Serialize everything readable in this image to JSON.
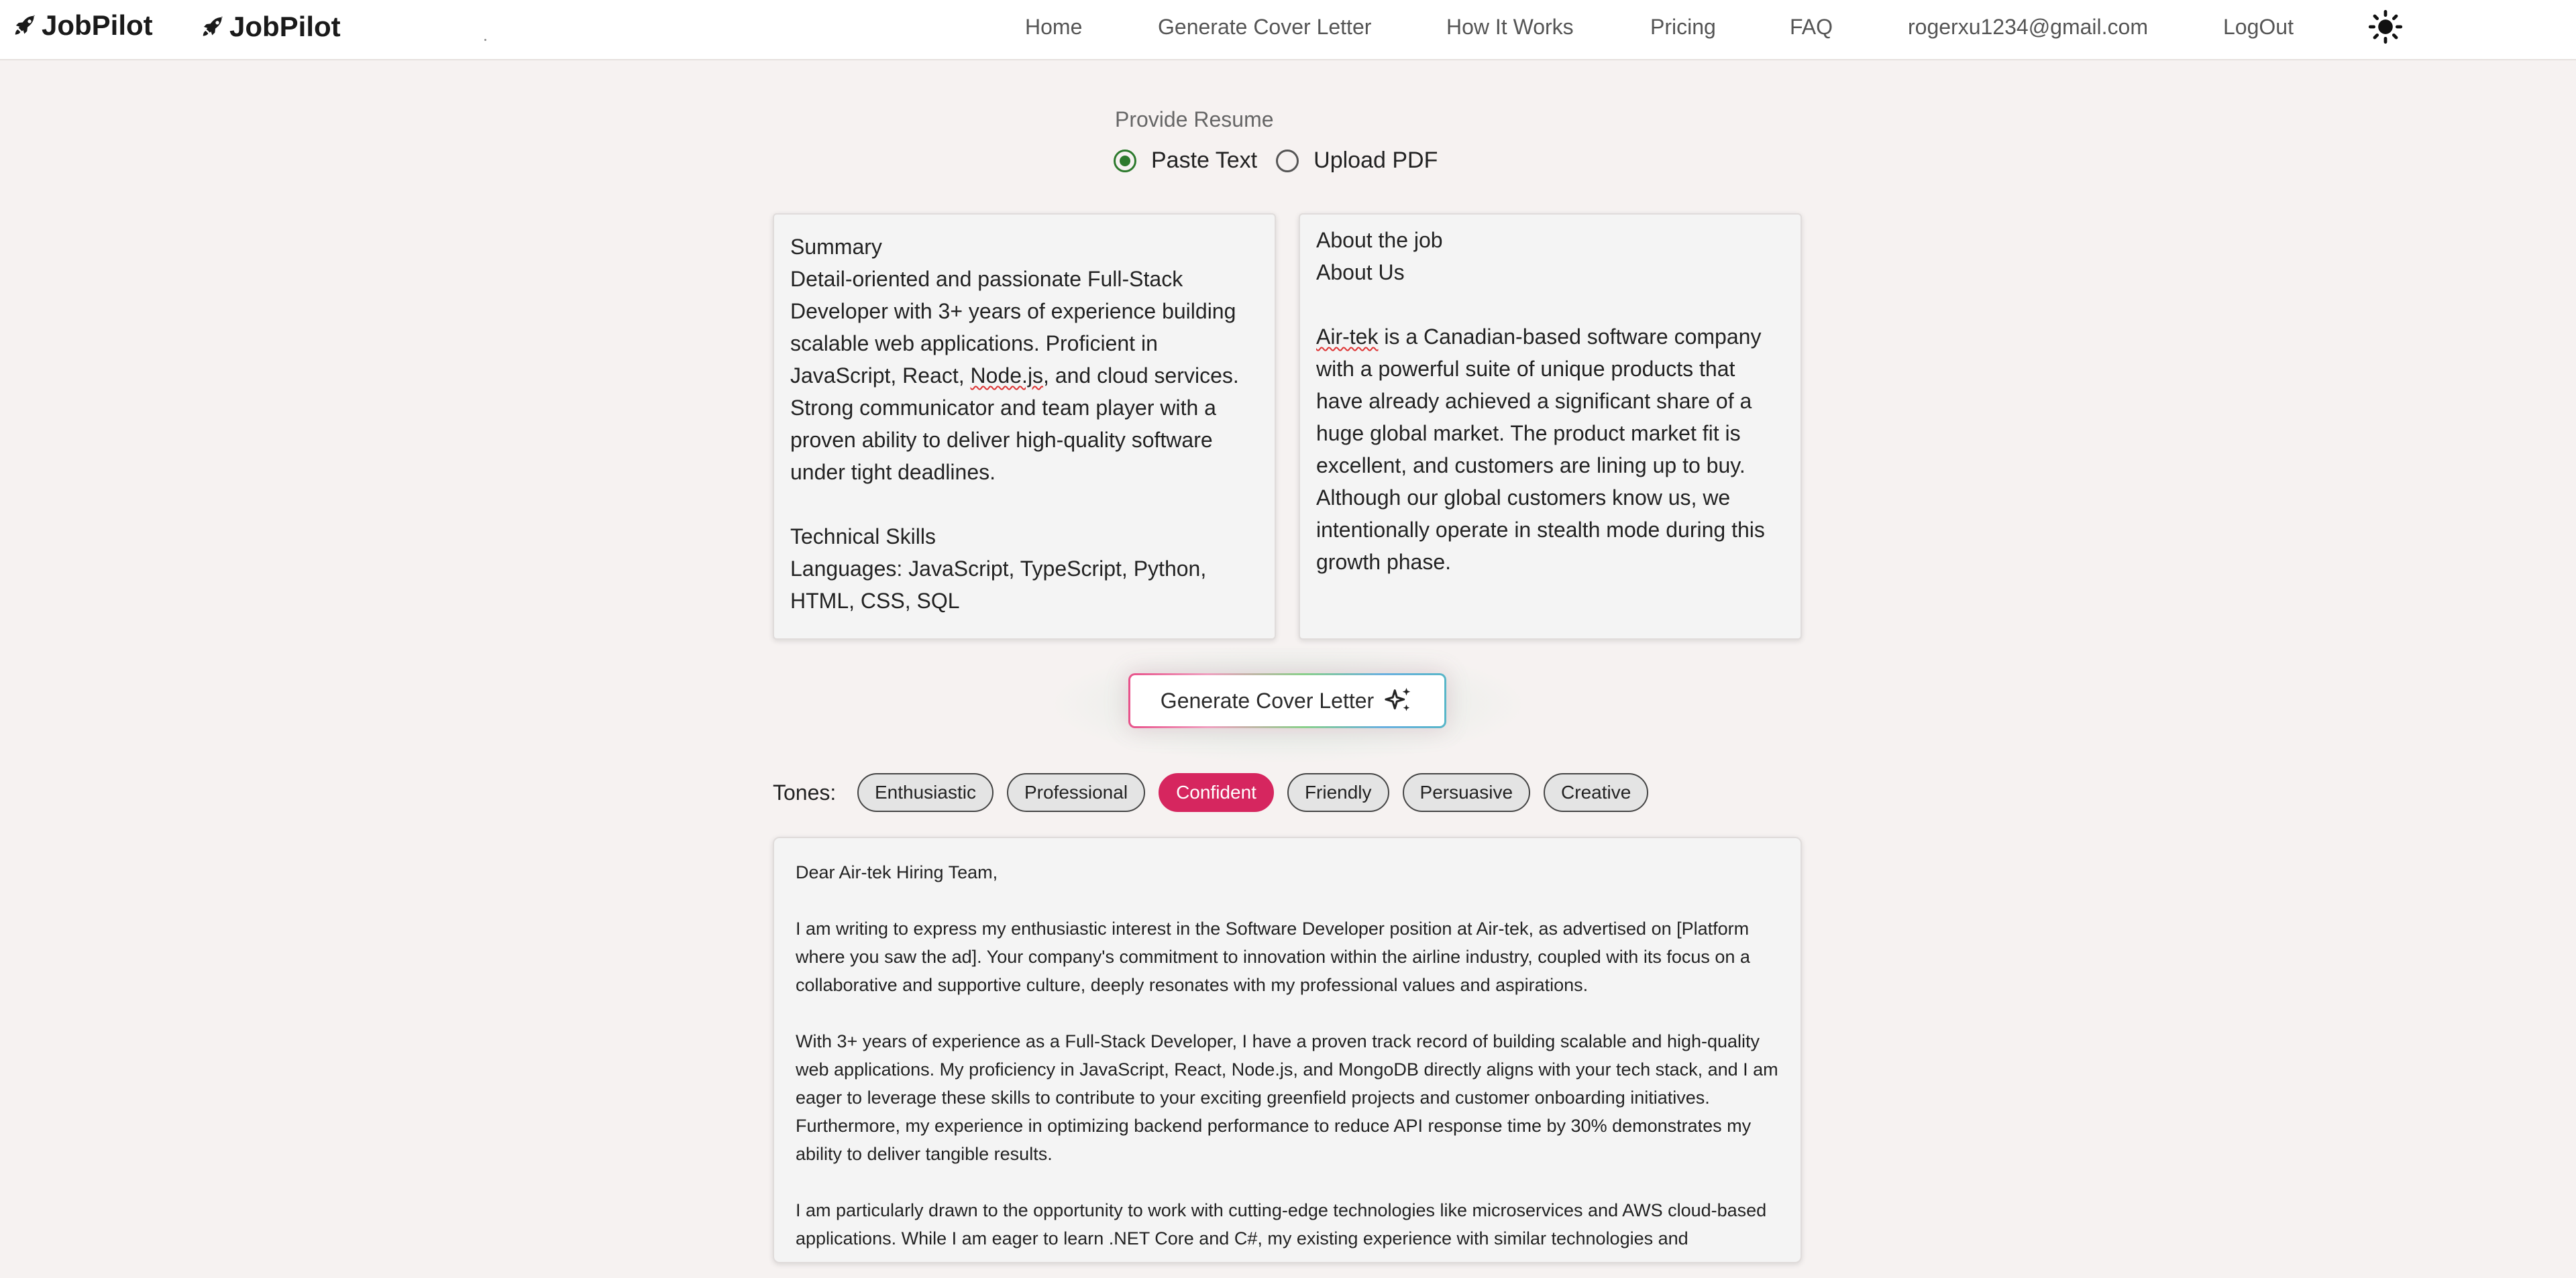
{
  "header": {
    "brand": "JobPilot",
    "nav": {
      "home": "Home",
      "generate": "Generate Cover Letter",
      "how": "How It Works",
      "pricing": "Pricing",
      "faq": "FAQ",
      "email": "rogerxu1234@gmail.com",
      "logout": "LogOut"
    },
    "theme_icon": "sun-icon"
  },
  "resume_source": {
    "label": "Provide Resume",
    "options": [
      "Paste Text",
      "Upload PDF"
    ],
    "selected": "Paste Text"
  },
  "resume_text": {
    "before": "Summary\nDetail-oriented and passionate Full-Stack Developer with 3+ years of experience building scalable web applications. Proficient in JavaScript, React, ",
    "flagged": "Node.js",
    "after": ", and cloud services. Strong communicator and team player with a proven ability to deliver high-quality software under tight deadlines.\n\nTechnical Skills\nLanguages: JavaScript, TypeScript, Python, HTML, CSS, SQL"
  },
  "job_text": {
    "before": "About the job\nAbout Us\n\n",
    "flagged": "Air-tek",
    "after": " is a Canadian-based software company with a powerful suite of unique products that have already achieved a significant share of a huge global market. The product market fit is excellent, and customers are lining up to buy. Although our global customers know us, we intentionally operate in stealth mode during this growth phase."
  },
  "generate_button": {
    "label": "Generate Cover Letter",
    "icon": "sparkle-icon"
  },
  "tones": {
    "label": "Tones:",
    "items": [
      "Enthusiastic",
      "Professional",
      "Confident",
      "Friendly",
      "Persuasive",
      "Creative"
    ],
    "selected": "Confident"
  },
  "letter": {
    "text": "Dear Air-tek Hiring Team,\n\nI am writing to express my enthusiastic interest in the Software Developer position at Air-tek, as advertised on [Platform where you saw the ad]. Your company's commitment to innovation within the airline industry, coupled with its focus on a collaborative and supportive culture, deeply resonates with my professional values and aspirations.\n\nWith 3+ years of experience as a Full-Stack Developer, I have a proven track record of building scalable and high-quality web applications. My proficiency in JavaScript, React, Node.js, and MongoDB directly aligns with your tech stack, and I am eager to leverage these skills to contribute to your exciting greenfield projects and customer onboarding initiatives. Furthermore, my experience in optimizing backend performance to reduce API response time by 30% demonstrates my ability to deliver tangible results.\n\nI am particularly drawn to the opportunity to work with cutting-edge technologies like microservices and AWS cloud-based applications. While I am eager to learn .NET Core and C#, my existing experience with similar technologies and"
  }
}
